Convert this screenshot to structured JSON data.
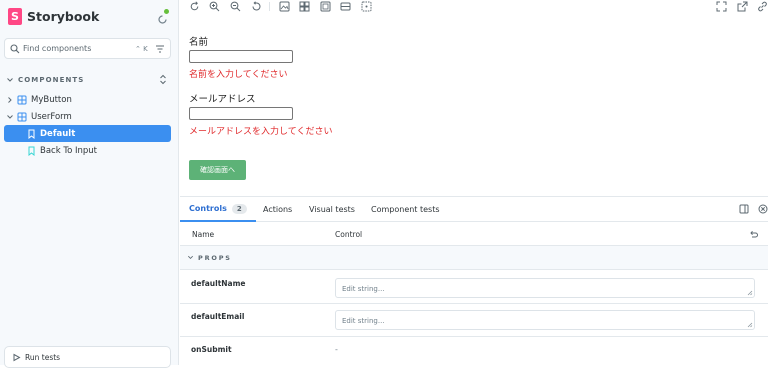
{
  "brand": {
    "name": "Storybook",
    "logo_letter": "S"
  },
  "search": {
    "placeholder": "Find components",
    "shortcut": "⌃ K"
  },
  "sidebar": {
    "section_label": "COMPONENTS",
    "items": [
      {
        "label": "MyButton",
        "type": "component",
        "expanded": false
      },
      {
        "label": "UserForm",
        "type": "component",
        "expanded": true
      },
      {
        "label": "Default",
        "type": "story",
        "selected": true
      },
      {
        "label": "Back To Input",
        "type": "story",
        "selected": false
      }
    ],
    "run_tests_label": "Run tests"
  },
  "toolbar": {
    "icons": [
      "reload-icon",
      "zoom-in-icon",
      "zoom-out-icon",
      "zoom-reset-icon",
      "background-icon",
      "grid-icon",
      "viewport-icon",
      "measure-icon",
      "outline-icon",
      "fullscreen-icon",
      "open-new-tab-icon",
      "copy-link-icon"
    ]
  },
  "story": {
    "name_label": "名前",
    "name_error": "名前を入力してください",
    "email_label": "メールアドレス",
    "email_error": "メールアドレスを入力してください",
    "confirm_button": "確認画面へ"
  },
  "panel": {
    "tabs": [
      {
        "label": "Controls",
        "badge": "2",
        "active": true
      },
      {
        "label": "Actions",
        "active": false
      },
      {
        "label": "Visual tests",
        "active": false
      },
      {
        "label": "Component tests",
        "active": false
      }
    ],
    "columns": {
      "name": "Name",
      "control": "Control"
    },
    "group_label": "PROPS",
    "props": [
      {
        "name": "defaultName",
        "control": "text",
        "placeholder": "Edit string..."
      },
      {
        "name": "defaultEmail",
        "control": "text",
        "placeholder": "Edit string..."
      },
      {
        "name": "onSubmit",
        "control": "none",
        "value": "-"
      }
    ]
  },
  "colors": {
    "accent": "#3b8ff0",
    "brand": "#ff4785",
    "error": "#e0292b",
    "button": "#5db277"
  }
}
